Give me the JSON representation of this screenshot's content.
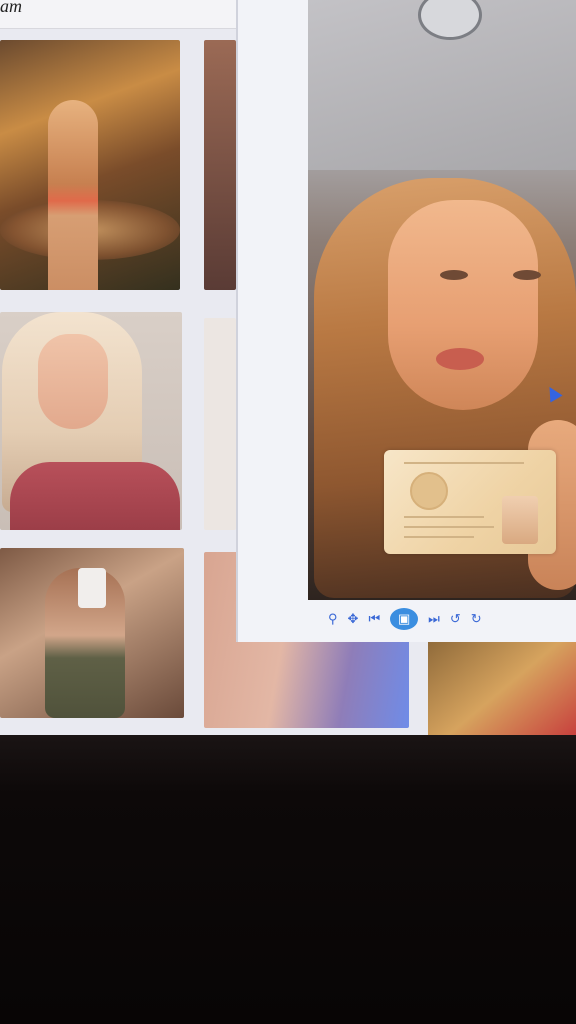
{
  "browser": {
    "tab_title_fragment": "am"
  },
  "gallery": {
    "thumbnails": [
      {
        "label": "carousel-photo"
      },
      {
        "label": "partial-photo"
      },
      {
        "label": "blonde-selfie"
      },
      {
        "label": "partial-photo"
      },
      {
        "label": "mirror-selfie"
      },
      {
        "label": "blurred-photo"
      },
      {
        "label": "partial-photo"
      }
    ]
  },
  "viewer": {
    "controls": {
      "zoom": "⚲",
      "fit": "✥",
      "prev": "⏮",
      "play": "▣",
      "next": "⏭",
      "rotate_left": "↺",
      "rotate_right": "↻"
    }
  },
  "colors": {
    "accent": "#3a68d6",
    "screen_bg": "#e9eaf1",
    "bezel": "#0b0707"
  }
}
